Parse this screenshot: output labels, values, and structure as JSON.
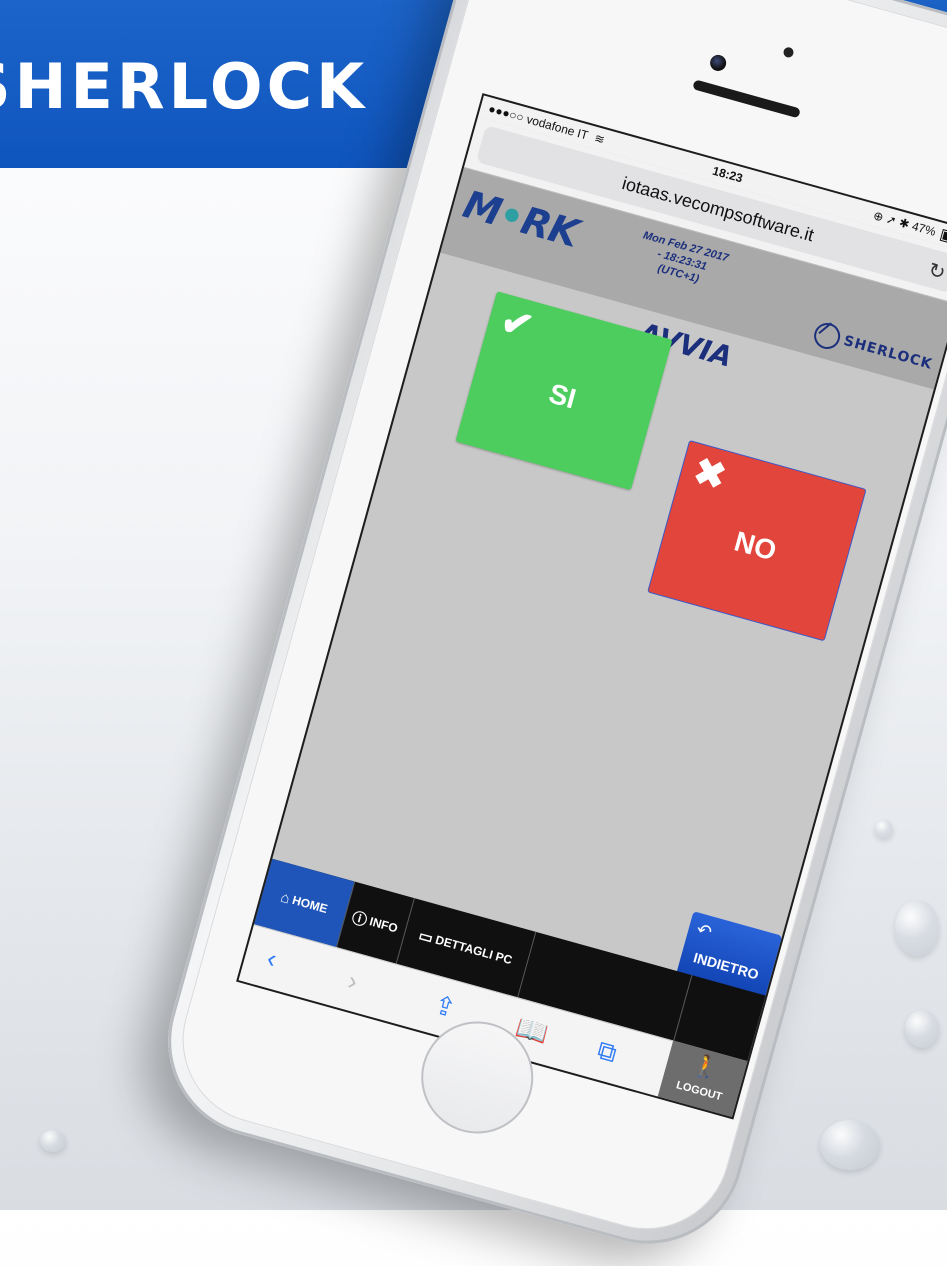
{
  "banner": {
    "title": "SHERLOCK"
  },
  "status_bar": {
    "carrier": "●●●○○ vodafone IT",
    "wifi_icon": "wifi-icon",
    "time": "18:23",
    "indicators": "⊕ ➚ ✱",
    "battery_percent": "47%",
    "battery_level": 0.47
  },
  "url_bar": {
    "url": "iotaas.vecompsoftware.it",
    "reload_icon": "reload-icon"
  },
  "header": {
    "logo_prefix": "M",
    "logo_dot": "•",
    "logo_suffix": "RK",
    "date_line1": "Mon Feb 27 2017",
    "date_line2": "- 18:23:31",
    "date_line3": "(UTC+1)",
    "brand": "SHERLOCK"
  },
  "page": {
    "title": "AVVIA",
    "yes_label": "SI",
    "yes_icon": "checkmark-icon",
    "no_label": "NO",
    "no_icon": "x-icon"
  },
  "nav": {
    "home": "HOME",
    "info": "INFO",
    "details": "DETTAGLI PC",
    "back": "INDIETRO",
    "logout": "LOGOUT"
  },
  "toolbar": {
    "back": "‹",
    "forward": "›",
    "share": "⇪",
    "bookmarks": "📖",
    "tabs": "⧉"
  },
  "colors": {
    "banner": "#1c64c9",
    "yes": "#4ccd5d",
    "no": "#e2453b",
    "nav_active": "#1f55b8",
    "brand_text": "#1b2f7c"
  }
}
